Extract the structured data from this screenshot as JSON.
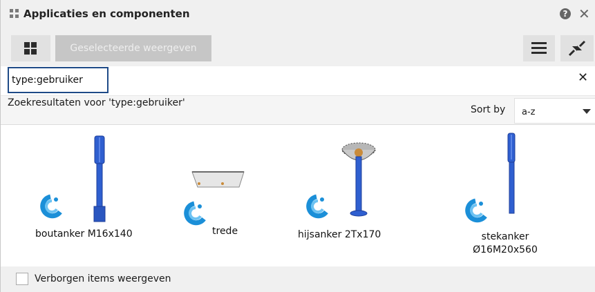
{
  "panel": {
    "title": "Applicaties en componenten",
    "help_glyph": "?",
    "close_glyph": "✕"
  },
  "toolbar": {
    "show_selected_label": "Geselecteerde weergeven"
  },
  "search": {
    "value": "type:gebruiker",
    "clear_glyph": "✕"
  },
  "results": {
    "summary": "Zoekresultaten voor 'type:gebruiker'",
    "sort_label": "Sort by",
    "sort_value": "a-z"
  },
  "items": [
    {
      "label": "boutanker M16x140"
    },
    {
      "label": "trede"
    },
    {
      "label": "hijsanker 2Tx170"
    },
    {
      "label_line1": "stekanker",
      "label_line2": "Ø16M20x560"
    }
  ],
  "footer": {
    "hidden_items_label": "Verborgen items weergeven",
    "hidden_items_checked": false
  },
  "colors": {
    "accent": "#1e4a87",
    "component_blue": "#2f5fd0",
    "brand_icon": "#1b8fd8"
  },
  "icons": [
    "grip-icon",
    "help-icon",
    "close-icon",
    "grid-view-icon",
    "hamburger-menu-icon",
    "collapse-icon",
    "clear-search-icon",
    "dropdown-caret-icon",
    "custom-component-icon"
  ]
}
